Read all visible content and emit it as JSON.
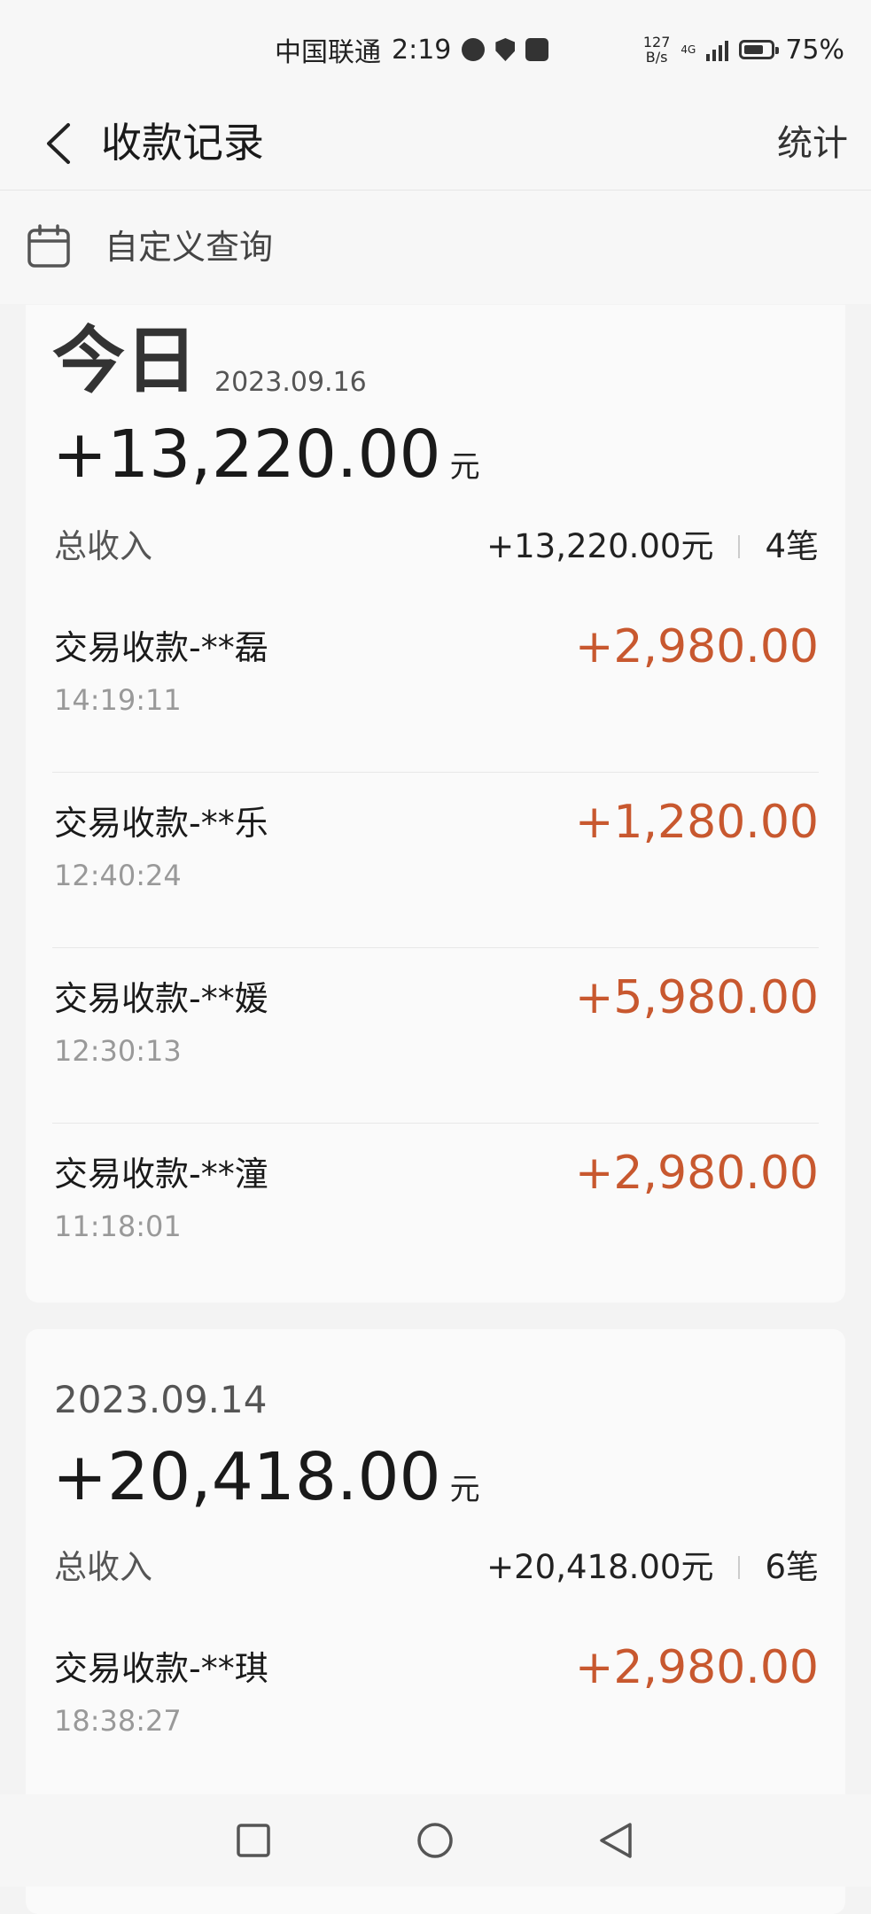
{
  "status_bar": {
    "carrier": "中国联通",
    "time": "2:19",
    "speed_top": "127",
    "speed_bottom": "B/s",
    "network": "4G",
    "battery": "75%",
    "battery_level": 0.75
  },
  "header": {
    "title": "收款记录",
    "stats_label": "统计"
  },
  "query": {
    "label": "自定义查询"
  },
  "days": [
    {
      "today_label": "今日",
      "date": "2023.09.16",
      "total": "+13,220.00",
      "unit": "元",
      "sum_label": "总收入",
      "sum_value": "+13,220.00元",
      "count": "4笔",
      "transactions": [
        {
          "name": "交易收款-**磊",
          "time": "14:19:11",
          "amount": "+2,980.00"
        },
        {
          "name": "交易收款-**乐",
          "time": "12:40:24",
          "amount": "+1,280.00"
        },
        {
          "name": "交易收款-**媛",
          "time": "12:30:13",
          "amount": "+5,980.00"
        },
        {
          "name": "交易收款-**潼",
          "time": "11:18:01",
          "amount": "+2,980.00"
        }
      ]
    },
    {
      "date": "2023.09.14",
      "total": "+20,418.00",
      "unit": "元",
      "sum_label": "总收入",
      "sum_value": "+20,418.00元",
      "count": "6笔",
      "transactions": [
        {
          "name": "交易收款-**琪",
          "time": "18:38:27",
          "amount": "+2,980.00"
        }
      ]
    }
  ],
  "colors": {
    "amount": "#c8582f",
    "background": "#f3f3f3"
  }
}
